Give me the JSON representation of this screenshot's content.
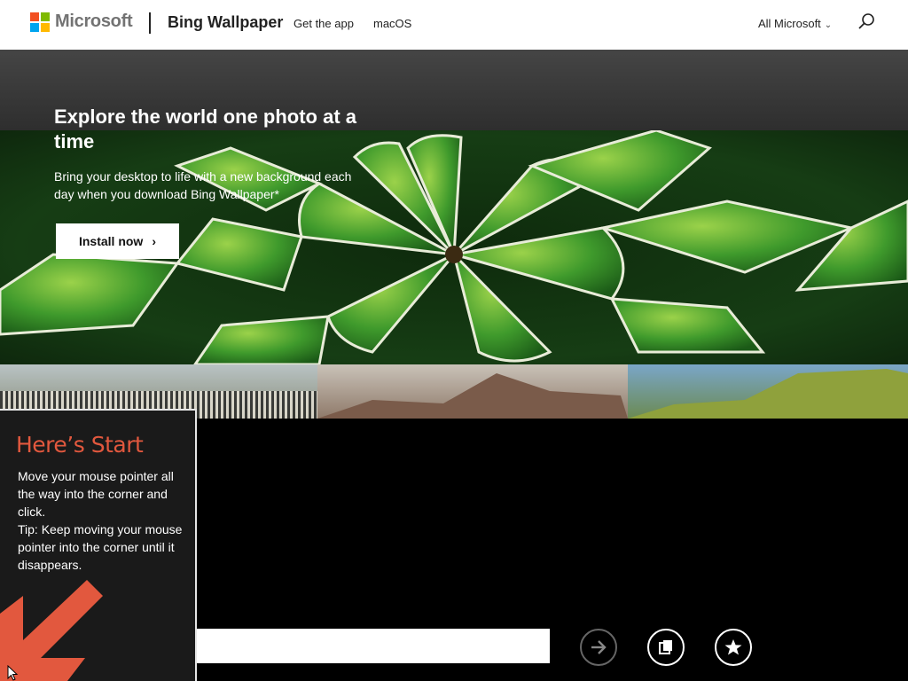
{
  "header": {
    "brand": "Microsoft",
    "brand_colors": [
      "#f25022",
      "#7fba00",
      "#00a4ef",
      "#ffb900"
    ],
    "product": "Bing Wallpaper",
    "nav": [
      "Get the app",
      "macOS"
    ],
    "all_microsoft": "All Microsoft",
    "search_icon": "search-icon"
  },
  "hero": {
    "title": "Explore the world one photo at a time",
    "subtitle": "Bring your desktop to life with a new background each day when you download Bing Wallpaper*",
    "install_label": "Install now"
  },
  "start_tip": {
    "title": "Here’s Start",
    "lines": [
      "Move your mouse pointer all the way into the corner and click.",
      "Tip: Keep moving your mouse pointer into the corner until it disappears."
    ],
    "accent": "#e2583e"
  },
  "bottom_bar": {
    "search_value": "",
    "buttons": [
      "arrow-right-icon",
      "copy-icon",
      "star-icon"
    ]
  }
}
